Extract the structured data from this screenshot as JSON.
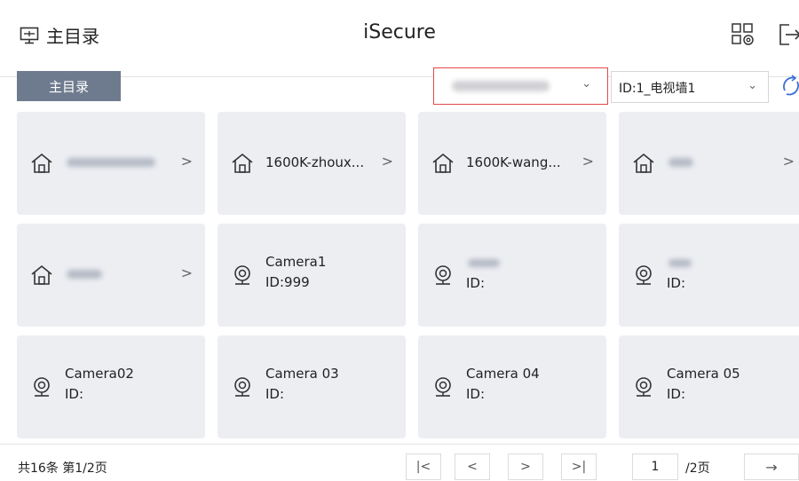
{
  "header": {
    "menu_label": "主目录",
    "app_title": "iSecure",
    "icons": [
      "monitor-menu-icon",
      "layout-settings-icon",
      "logout-icon"
    ]
  },
  "toolbar": {
    "breadcrumb": "主目录",
    "server_select_value": "",
    "wall_select_value": "ID:1_电视墙1"
  },
  "cards": [
    {
      "type": "folder",
      "name": ""
    },
    {
      "type": "folder",
      "name": "1600K-zhoux..."
    },
    {
      "type": "folder",
      "name": "1600K-wang..."
    },
    {
      "type": "folder",
      "name": ""
    },
    {
      "type": "folder",
      "name": ""
    },
    {
      "type": "camera",
      "name": "Camera1",
      "id": "ID:999"
    },
    {
      "type": "camera",
      "name": "",
      "id": "ID:"
    },
    {
      "type": "camera",
      "name": "",
      "id": "ID:"
    },
    {
      "type": "camera",
      "name": "Camera02",
      "id": "ID:"
    },
    {
      "type": "camera",
      "name": "Camera 03",
      "id": "ID:"
    },
    {
      "type": "camera",
      "name": "Camera 04",
      "id": "ID:"
    },
    {
      "type": "camera",
      "name": "Camera 05",
      "id": "ID:"
    }
  ],
  "pagination": {
    "count_text": "共16条  第1/2页",
    "current_page": "1",
    "total_text": "/2页"
  }
}
